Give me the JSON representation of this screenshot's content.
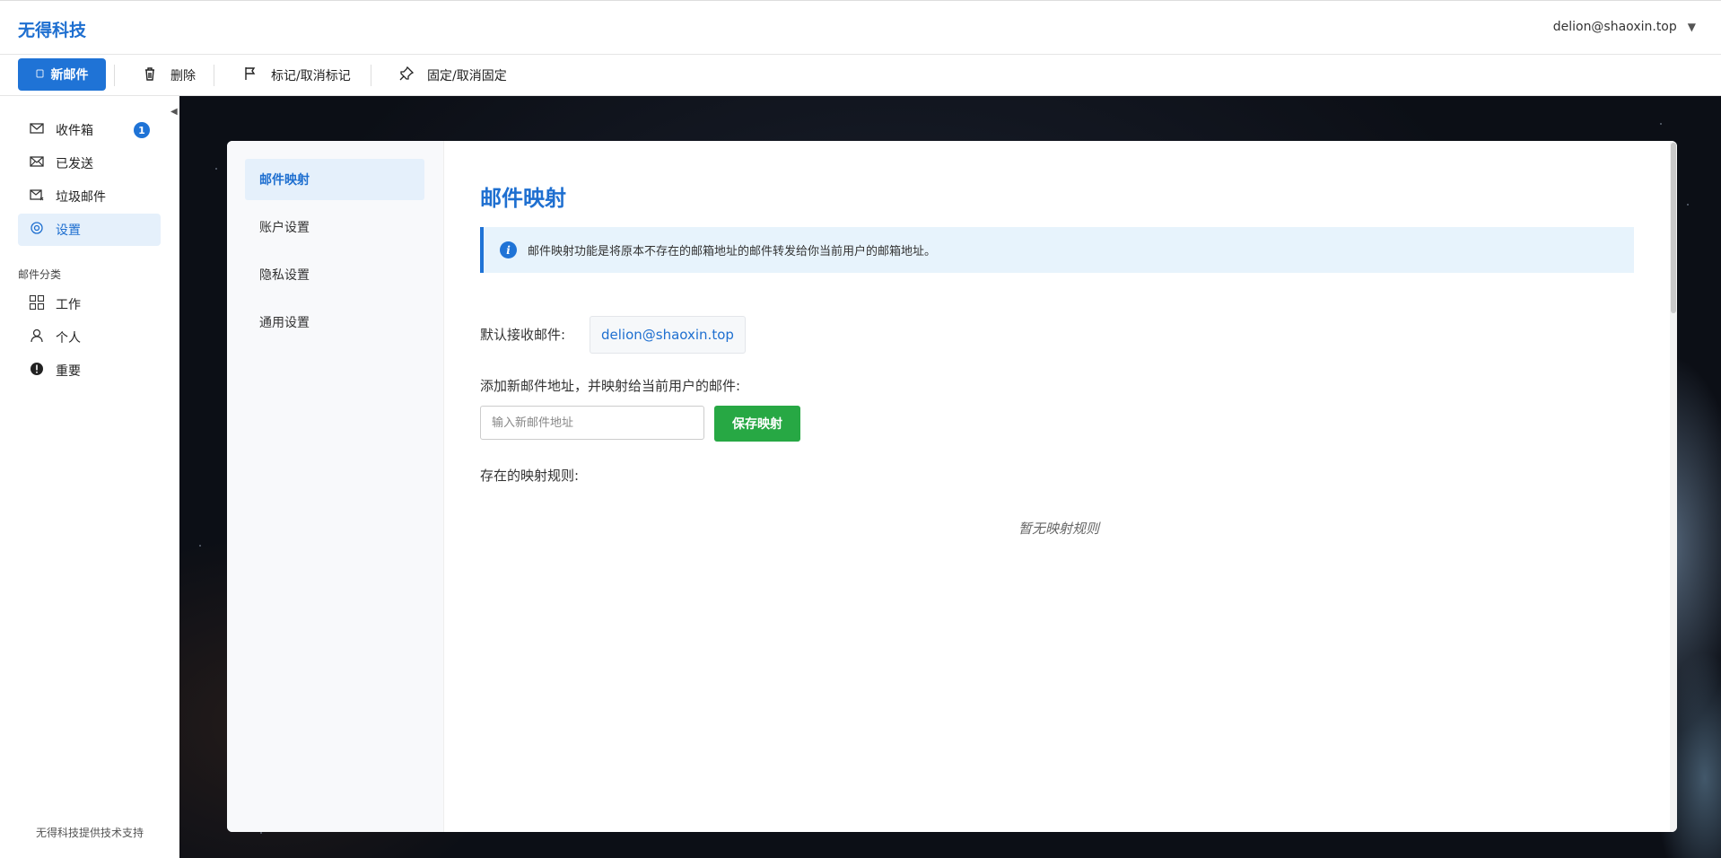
{
  "app": {
    "title": "无得科技"
  },
  "header": {
    "user_email": "delion@shaoxin.top",
    "caret": "▼"
  },
  "toolbar": {
    "new_mail": "新邮件",
    "delete": "删除",
    "flag_toggle": "标记/取消标记",
    "pin_toggle": "固定/取消固定"
  },
  "sidebar": {
    "collapse_glyph": "◀",
    "folders": [
      {
        "label": "收件箱",
        "badge": "1"
      },
      {
        "label": "已发送"
      },
      {
        "label": "垃圾邮件"
      },
      {
        "label": "设置"
      }
    ],
    "category_title": "邮件分类",
    "categories": [
      {
        "label": "工作"
      },
      {
        "label": "个人"
      },
      {
        "label": "重要"
      }
    ],
    "footer": "无得科技提供技术支持"
  },
  "settings": {
    "nav": [
      {
        "label": "邮件映射"
      },
      {
        "label": "账户设置"
      },
      {
        "label": "隐私设置"
      },
      {
        "label": "通用设置"
      }
    ],
    "title": "邮件映射",
    "info_icon": "i",
    "info": "邮件映射功能是将原本不存在的邮箱地址的邮件转发给你当前用户的邮箱地址。",
    "default_label": "默认接收邮件:",
    "default_email": "delion@shaoxin.top",
    "add_label": "添加新邮件地址，并映射给当前用户的邮件:",
    "input_placeholder": "输入新邮件地址",
    "input_value": "",
    "save_button": "保存映射",
    "rules_label": "存在的映射规则:",
    "empty_rules": "暂无映射规则"
  },
  "colors": {
    "accent": "#1f73d6",
    "success": "#27a844",
    "info_bg": "#e7f3fc",
    "active_bg": "#e5f0fb"
  },
  "icons": {
    "new_mail": "compose-icon",
    "delete": "trash-icon",
    "flag": "flag-icon",
    "pin": "pin-icon",
    "inbox": "envelope-icon",
    "sent": "sent-envelope-icon",
    "spam": "spam-envelope-icon",
    "settings": "gear-icon",
    "work": "grid-icon",
    "personal": "person-icon",
    "important": "exclamation-icon"
  }
}
